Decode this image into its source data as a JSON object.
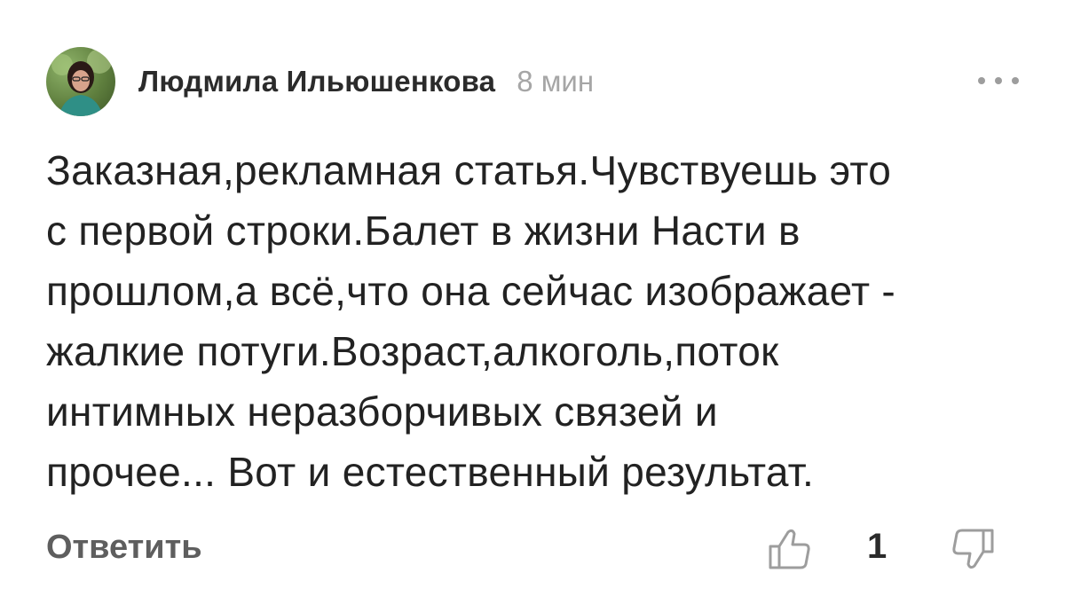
{
  "comment": {
    "author": "Людмила Ильюшенкова",
    "time": "8 мин",
    "text": "Заказная,рекламная статья.Чувствуешь это\nс первой строки.Балет в жизни Насти в\nпрошлом,а всё,что она сейчас изображает -\nжалкие потуги.Возраст,алкоголь,поток\nинтимных неразборчивых связей и\nпрочее... Вот и естественный результат.",
    "reply_label": "Ответить",
    "like_count": "1",
    "icons": {
      "avatar": "user-photo",
      "more": "more-dots-icon",
      "like": "thumbs-up-icon",
      "dislike": "thumbs-down-icon"
    },
    "colors": {
      "author": "#2b2b2b",
      "time": "#a6a6a6",
      "text": "#222222",
      "reply": "#5e5e5e",
      "icon": "#9d9d9d"
    }
  }
}
